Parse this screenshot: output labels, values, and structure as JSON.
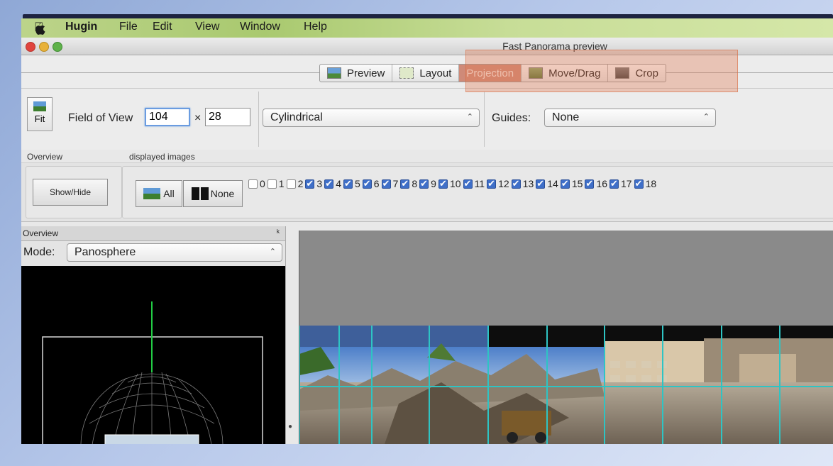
{
  "menu": {
    "apple_icon": "apple-icon",
    "app": "Hugin",
    "items": [
      "File",
      "Edit",
      "View",
      "Window",
      "Help"
    ]
  },
  "window": {
    "title": "Fast Panorama preview"
  },
  "toolbar": {
    "tabs": [
      {
        "label": "Preview",
        "icon": "preview-icon",
        "active": false
      },
      {
        "label": "Layout",
        "icon": "layout-icon",
        "active": false
      },
      {
        "label": "Projection",
        "icon": "",
        "active": true
      },
      {
        "label": "Move/Drag",
        "icon": "move-drag-icon",
        "active": false
      },
      {
        "label": "Crop",
        "icon": "crop-icon",
        "active": false
      }
    ],
    "highlight_color": "#e07850"
  },
  "fov": {
    "fit_label": "Fit",
    "label": "Field of View",
    "width": "104",
    "times": "×",
    "height": "28",
    "projection": "Cylindrical",
    "guides_label": "Guides:",
    "guides_value": "None"
  },
  "sections": {
    "overview_label": "Overview",
    "displayed_label": "displayed images"
  },
  "images": {
    "showhide_label": "Show/Hide",
    "all_label": "All",
    "none_label": "None",
    "checkboxes": [
      {
        "label": "0",
        "checked": false
      },
      {
        "label": "1",
        "checked": false
      },
      {
        "label": "2",
        "checked": false
      },
      {
        "label": "3",
        "checked": true
      },
      {
        "label": "4",
        "checked": true
      },
      {
        "label": "5",
        "checked": true
      },
      {
        "label": "6",
        "checked": true
      },
      {
        "label": "7",
        "checked": true
      },
      {
        "label": "8",
        "checked": true
      },
      {
        "label": "9",
        "checked": true
      },
      {
        "label": "10",
        "checked": true
      },
      {
        "label": "11",
        "checked": true
      },
      {
        "label": "12",
        "checked": true
      },
      {
        "label": "13",
        "checked": true
      },
      {
        "label": "14",
        "checked": true
      },
      {
        "label": "15",
        "checked": true
      },
      {
        "label": "16",
        "checked": true
      },
      {
        "label": "17",
        "checked": true
      },
      {
        "label": "18",
        "checked": true
      }
    ]
  },
  "overview_pane": {
    "title": "Overview",
    "pin_icon": "pin-icon",
    "mode_label": "Mode:",
    "mode_value": "Panosphere"
  },
  "colors": {
    "grid": "#2ec4c4",
    "pole": "#22cc44"
  }
}
